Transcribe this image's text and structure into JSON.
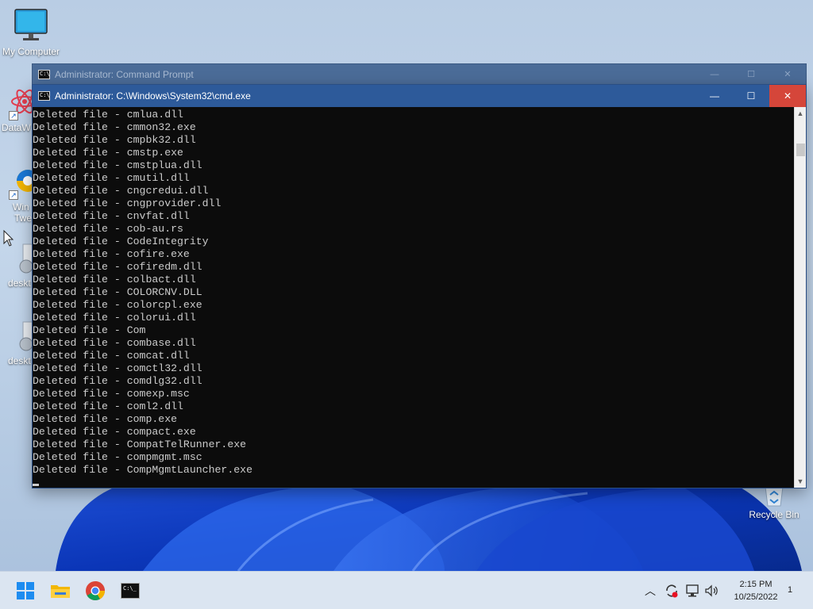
{
  "desktop": {
    "icons": [
      {
        "label": "My Computer"
      },
      {
        "label": "DataW"
      },
      {
        "label": "Win"
      },
      {
        "label": "Twe"
      },
      {
        "label": "deskt"
      },
      {
        "label": "deskt"
      },
      {
        "label": "Recycle Bin"
      }
    ]
  },
  "window_back": {
    "title": "Administrator: Command Prompt",
    "minimize_glyph": "—",
    "maximize_glyph": "☐",
    "close_glyph": "✕"
  },
  "window_front": {
    "title": "Administrator:  C:\\Windows\\System32\\cmd.exe",
    "minimize_glyph": "—",
    "maximize_glyph": "☐",
    "close_glyph": "✕",
    "icon_text": "C:\\"
  },
  "console": {
    "lines": [
      "Deleted file - cmlua.dll",
      "Deleted file - cmmon32.exe",
      "Deleted file - cmpbk32.dll",
      "Deleted file - cmstp.exe",
      "Deleted file - cmstplua.dll",
      "Deleted file - cmutil.dll",
      "Deleted file - cngcredui.dll",
      "Deleted file - cngprovider.dll",
      "Deleted file - cnvfat.dll",
      "Deleted file - cob-au.rs",
      "Deleted file - CodeIntegrity",
      "Deleted file - cofire.exe",
      "Deleted file - cofiredm.dll",
      "Deleted file - colbact.dll",
      "Deleted file - COLORCNV.DLL",
      "Deleted file - colorcpl.exe",
      "Deleted file - colorui.dll",
      "Deleted file - Com",
      "Deleted file - combase.dll",
      "Deleted file - comcat.dll",
      "Deleted file - comctl32.dll",
      "Deleted file - comdlg32.dll",
      "Deleted file - comexp.msc",
      "Deleted file - coml2.dll",
      "Deleted file - comp.exe",
      "Deleted file - compact.exe",
      "Deleted file - CompatTelRunner.exe",
      "Deleted file - compmgmt.msc",
      "Deleted file - CompMgmtLauncher.exe"
    ]
  },
  "scrollbar": {
    "up_glyph": "▲",
    "down_glyph": "▼"
  },
  "taskbar": {
    "apps": [
      {
        "icon": "windows-start-icon"
      },
      {
        "icon": "file-explorer-icon"
      },
      {
        "icon": "chrome-icon"
      },
      {
        "icon": "command-prompt-icon",
        "text": "C:\\_"
      }
    ],
    "tray": {
      "chevron_glyph": "︿",
      "time": "2:15 PM",
      "date": "10/25/2022",
      "notification_count": "1"
    }
  },
  "colors": {
    "titlebar_active": "#2d5a9a",
    "titlebar_inactive": "#4b6c98",
    "close_button": "#d5463a",
    "console_bg": "#0c0c0c",
    "console_text": "#cccccc"
  }
}
